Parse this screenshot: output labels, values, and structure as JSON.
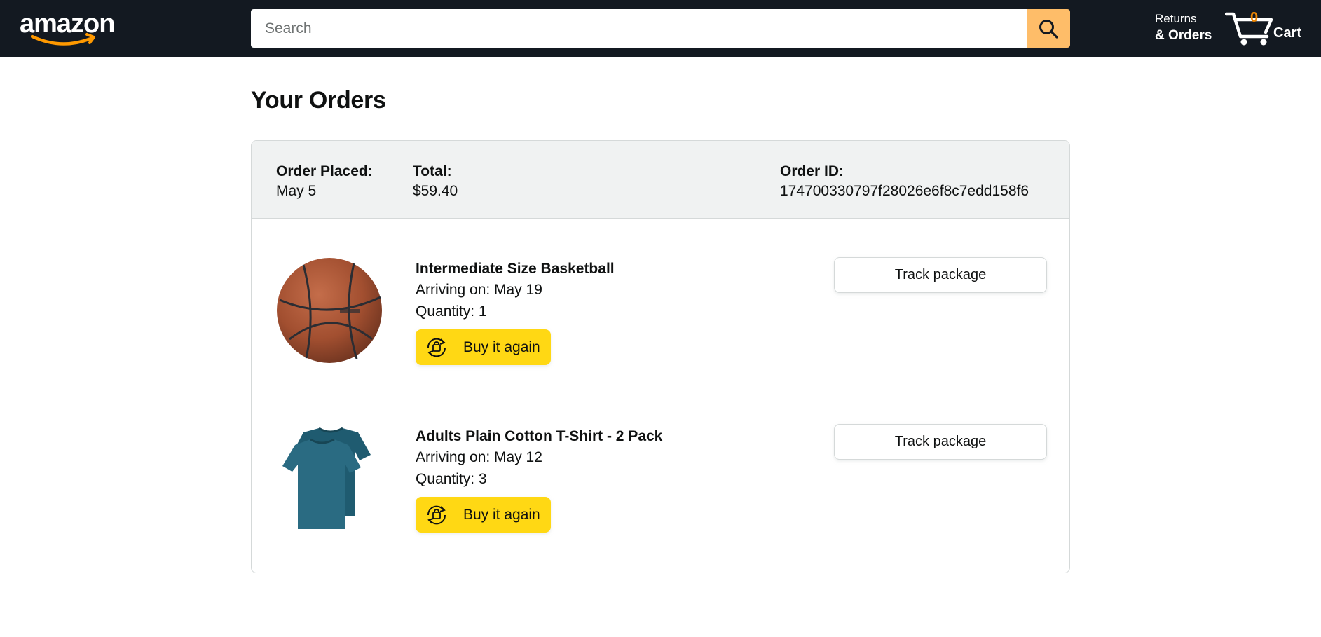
{
  "header": {
    "logo_text": "amazon",
    "search": {
      "placeholder": "Search",
      "value": ""
    },
    "returns_top": "Returns",
    "returns_bottom": "& Orders",
    "cart_count": "0",
    "cart_label": "Cart"
  },
  "page": {
    "title": "Your Orders"
  },
  "order": {
    "placed_label": "Order Placed:",
    "placed_value": "May 5",
    "total_label": "Total:",
    "total_value": "$59.40",
    "id_label": "Order ID:",
    "id_value": "174700330797f28026e6f8c7edd158f6",
    "items": [
      {
        "name": "Intermediate Size Basketball",
        "arriving": "Arriving on: May 19",
        "quantity": "Quantity: 1",
        "buy_again": "Buy it again",
        "track": "Track package",
        "image": "basketball"
      },
      {
        "name": "Adults Plain Cotton T-Shirt - 2 Pack",
        "arriving": "Arriving on: May 12",
        "quantity": "Quantity: 3",
        "buy_again": "Buy it again",
        "track": "Track package",
        "image": "teal-t-shirts"
      }
    ]
  },
  "colors": {
    "header_bg": "#131921",
    "search_button": "#febd69",
    "cart_count": "#f08804",
    "buy_again": "#ffd814",
    "order_header_bg": "#f0f2f2"
  }
}
